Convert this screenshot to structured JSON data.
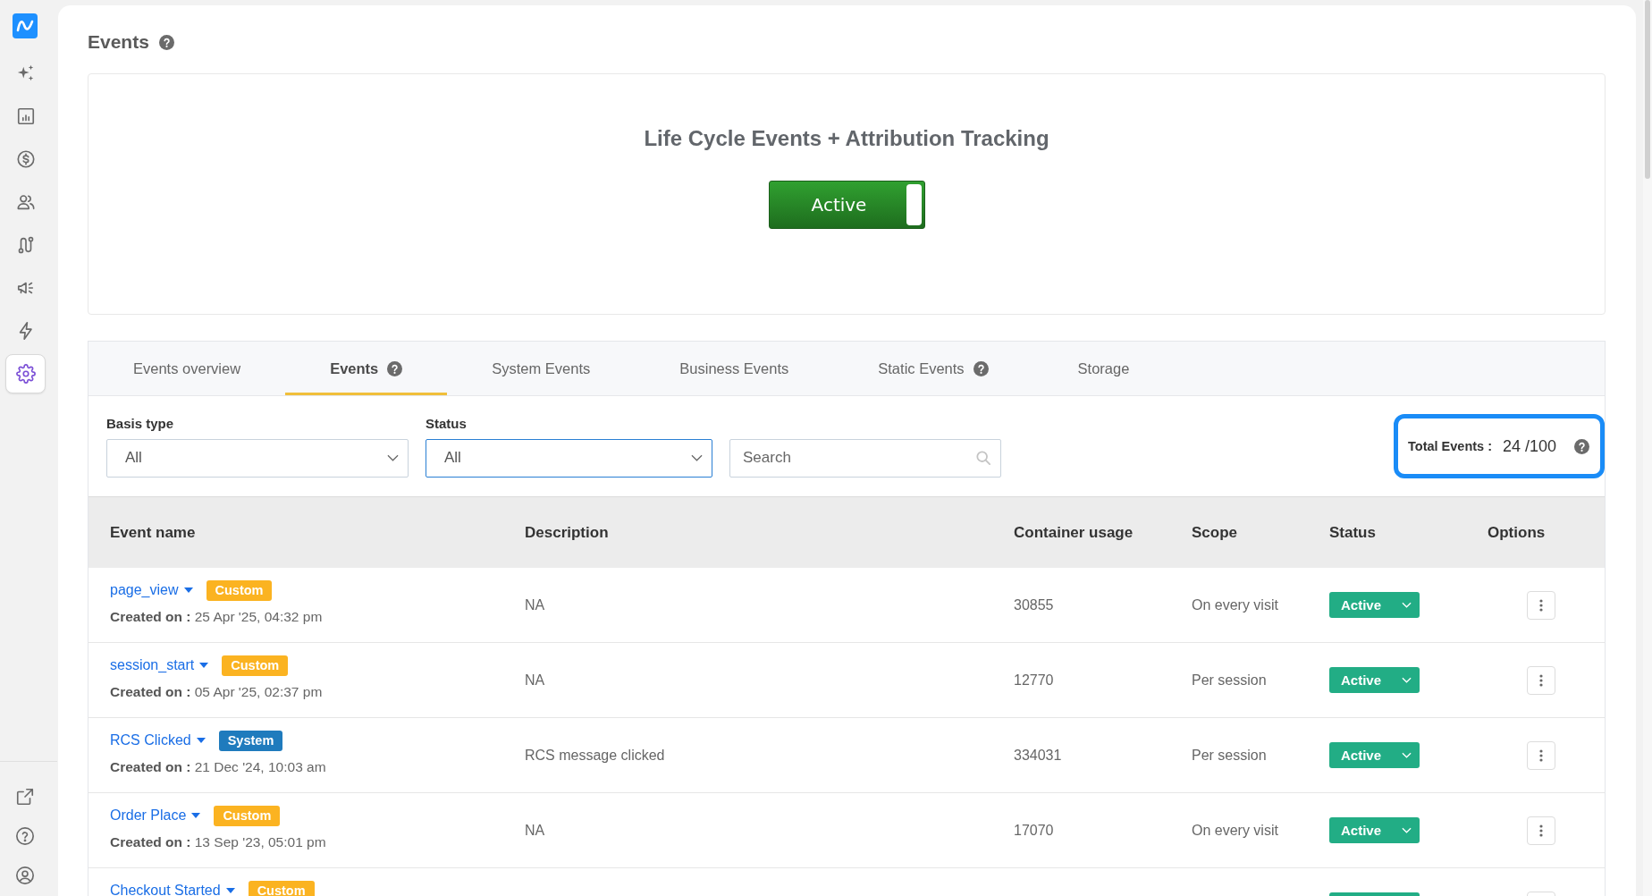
{
  "sidebar": {
    "nav": [
      {
        "selected": false
      },
      {
        "selected": false
      },
      {
        "selected": false
      },
      {
        "selected": false
      },
      {
        "selected": false
      },
      {
        "selected": false
      },
      {
        "selected": false
      },
      {
        "selected": true
      }
    ]
  },
  "page": {
    "title": "Events"
  },
  "tracking_panel": {
    "title": "Life Cycle Events + Attribution Tracking",
    "toggle": {
      "label": "Active",
      "on": true
    }
  },
  "tabs": [
    {
      "label": "Events overview",
      "selected": false,
      "help": false
    },
    {
      "label": "Events",
      "selected": true,
      "help": true
    },
    {
      "label": "System Events",
      "selected": false,
      "help": false
    },
    {
      "label": "Business Events",
      "selected": false,
      "help": false
    },
    {
      "label": "Static Events",
      "selected": false,
      "help": true
    },
    {
      "label": "Storage",
      "selected": false,
      "help": false
    }
  ],
  "filters": {
    "basis_type": {
      "label": "Basis type",
      "value": "All",
      "focused": false
    },
    "status": {
      "label": "Status",
      "value": "All",
      "focused": true
    },
    "search": {
      "placeholder": "Search"
    }
  },
  "total_events": {
    "label": "Total Events :",
    "value": "24 /100",
    "highlighted": true
  },
  "table": {
    "columns": [
      "Event name",
      "Description",
      "Container usage",
      "Scope",
      "Status",
      "Options"
    ],
    "rows": [
      {
        "name": "page_view",
        "badge": {
          "label": "Custom",
          "kind": "custom"
        },
        "created": "**Created on :** 25 Apr '25, 04:32 pm",
        "description": "NA",
        "container_usage": "30855",
        "scope": "On every visit",
        "status": "Active"
      },
      {
        "name": "session_start",
        "badge": {
          "label": "Custom",
          "kind": "custom"
        },
        "created": "**Created on :** 05 Apr '25, 02:37 pm",
        "description": "NA",
        "container_usage": "12770",
        "scope": "Per session",
        "status": "Active"
      },
      {
        "name": "RCS Clicked",
        "badge": {
          "label": "System",
          "kind": "system"
        },
        "created": "**Created on :** 21 Dec '24, 10:03 am",
        "description": "RCS message clicked",
        "container_usage": "334031",
        "scope": "Per session",
        "status": "Active"
      },
      {
        "name": "Order Place",
        "badge": {
          "label": "Custom",
          "kind": "custom"
        },
        "created": "**Created on :** 13 Sep '23, 05:01 pm",
        "description": "NA",
        "container_usage": "17070",
        "scope": "On every visit",
        "status": "Active"
      },
      {
        "name": "Checkout Started",
        "badge": {
          "label": "Custom",
          "kind": "custom"
        }
      }
    ]
  }
}
